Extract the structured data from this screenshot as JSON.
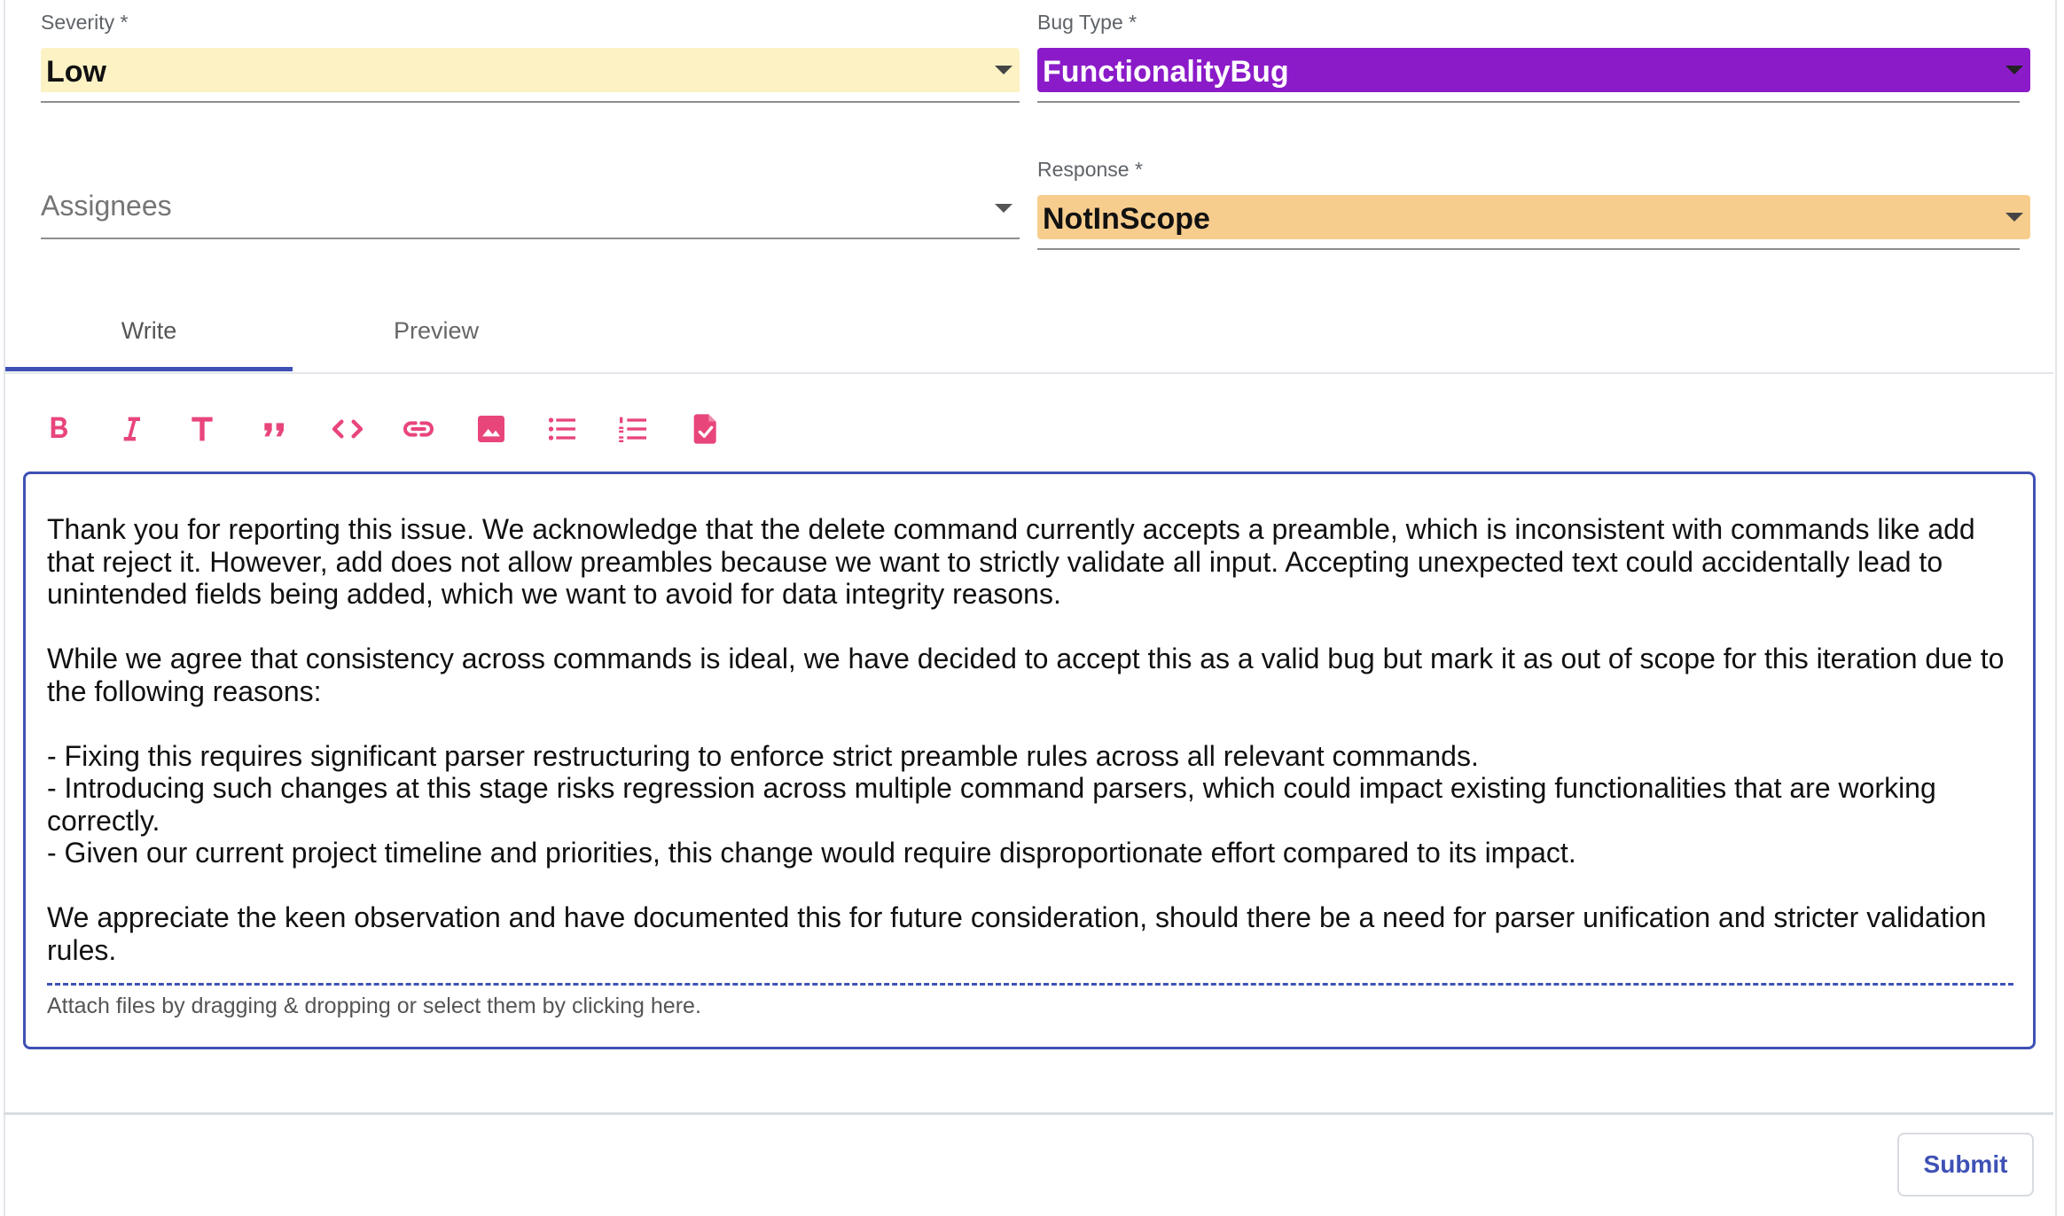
{
  "severity": {
    "label": "Severity *",
    "value": "Low",
    "color": "#fdf2c4"
  },
  "bug_type": {
    "label": "Bug Type *",
    "value": "FunctionalityBug",
    "color": "#8b1bc9"
  },
  "assignees": {
    "placeholder": "Assignees"
  },
  "response": {
    "label": "Response *",
    "value": "NotInScope",
    "color": "#f7cd8e"
  },
  "tabs": [
    {
      "label": "Write",
      "active": true
    },
    {
      "label": "Preview",
      "active": false
    }
  ],
  "toolbar": {
    "icons": [
      "bold-icon",
      "italic-icon",
      "heading-icon",
      "quote-icon",
      "code-icon",
      "link-icon",
      "image-icon",
      "bulleted-list-icon",
      "numbered-list-icon",
      "task-list-icon"
    ],
    "icon_color": "#e8457b"
  },
  "editor": {
    "text": "Thank you for reporting this issue. We acknowledge that the delete command currently accepts a preamble, which is inconsistent with commands like add that reject it. However, add does not allow preambles because we want to strictly validate all input. Accepting unexpected text could accidentally lead to unintended fields being added, which we want to avoid for data integrity reasons.\n\nWhile we agree that consistency across commands is ideal, we have decided to accept this as a valid bug but mark it as out of scope for this iteration due to the following reasons:\n\n- Fixing this requires significant parser restructuring to enforce strict preamble rules across all relevant commands.\n- Introducing such changes at this stage risks regression across multiple command parsers, which could impact existing functionalities that are working correctly.\n- Given our current project timeline and priorities, this change would require disproportionate effort compared to its impact.\n\nWe appreciate the keen observation and have documented this for future consideration, should there be a need for parser unification and stricter validation rules.",
    "attach_hint": "Attach files by dragging & dropping or select them by clicking here."
  },
  "submit_label": "Submit"
}
